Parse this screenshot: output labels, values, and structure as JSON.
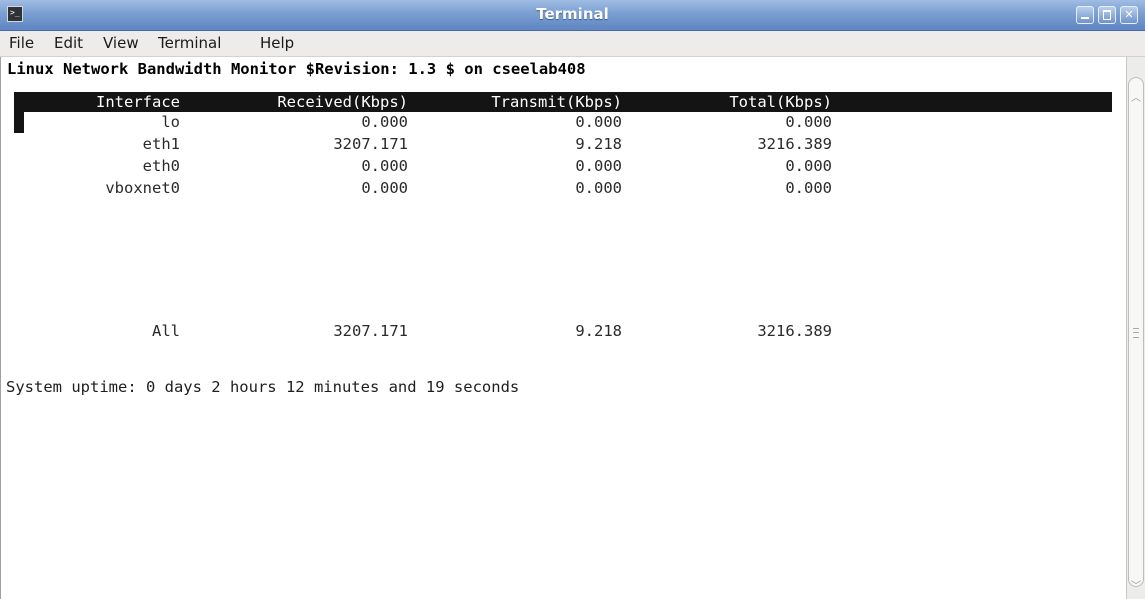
{
  "window": {
    "title": "Terminal",
    "icon": "terminal-icon",
    "icon_glyph": ">_",
    "controls": {
      "minimize": "minimize-icon",
      "maximize": "maximize-icon",
      "close": "close-icon",
      "close_glyph": "✕"
    },
    "colors": {
      "titlebar": "#7b9fd2",
      "header_bg": "#141414",
      "header_text": "#ffffff"
    }
  },
  "menu": [
    "File",
    "Edit",
    "View",
    "Terminal",
    "Help"
  ],
  "terminal": {
    "heading": "Linux Network Bandwidth Monitor $Revision: 1.3 $ on cseelab408",
    "columns": [
      "Interface",
      "Received(Kbps)",
      "Transmit(Kbps)",
      "Total(Kbps)"
    ],
    "rows": [
      [
        "lo",
        "0.000",
        "0.000",
        "0.000"
      ],
      [
        "eth1",
        "3207.171",
        "9.218",
        "3216.389"
      ],
      [
        "eth0",
        "0.000",
        "0.000",
        "0.000"
      ],
      [
        "vboxnet0",
        "0.000",
        "0.000",
        "0.000"
      ]
    ],
    "summary": [
      "All",
      "3207.171",
      "9.218",
      "3216.389"
    ],
    "uptime": "System uptime: 0 days 2 hours 12 minutes and 19 seconds"
  },
  "scrollbar": {
    "up_icon": "chevron-up-icon",
    "down_icon": "chevron-down-icon",
    "up_glyph": "︿",
    "down_glyph": "﹀",
    "grip_icon": "grip-icon"
  }
}
